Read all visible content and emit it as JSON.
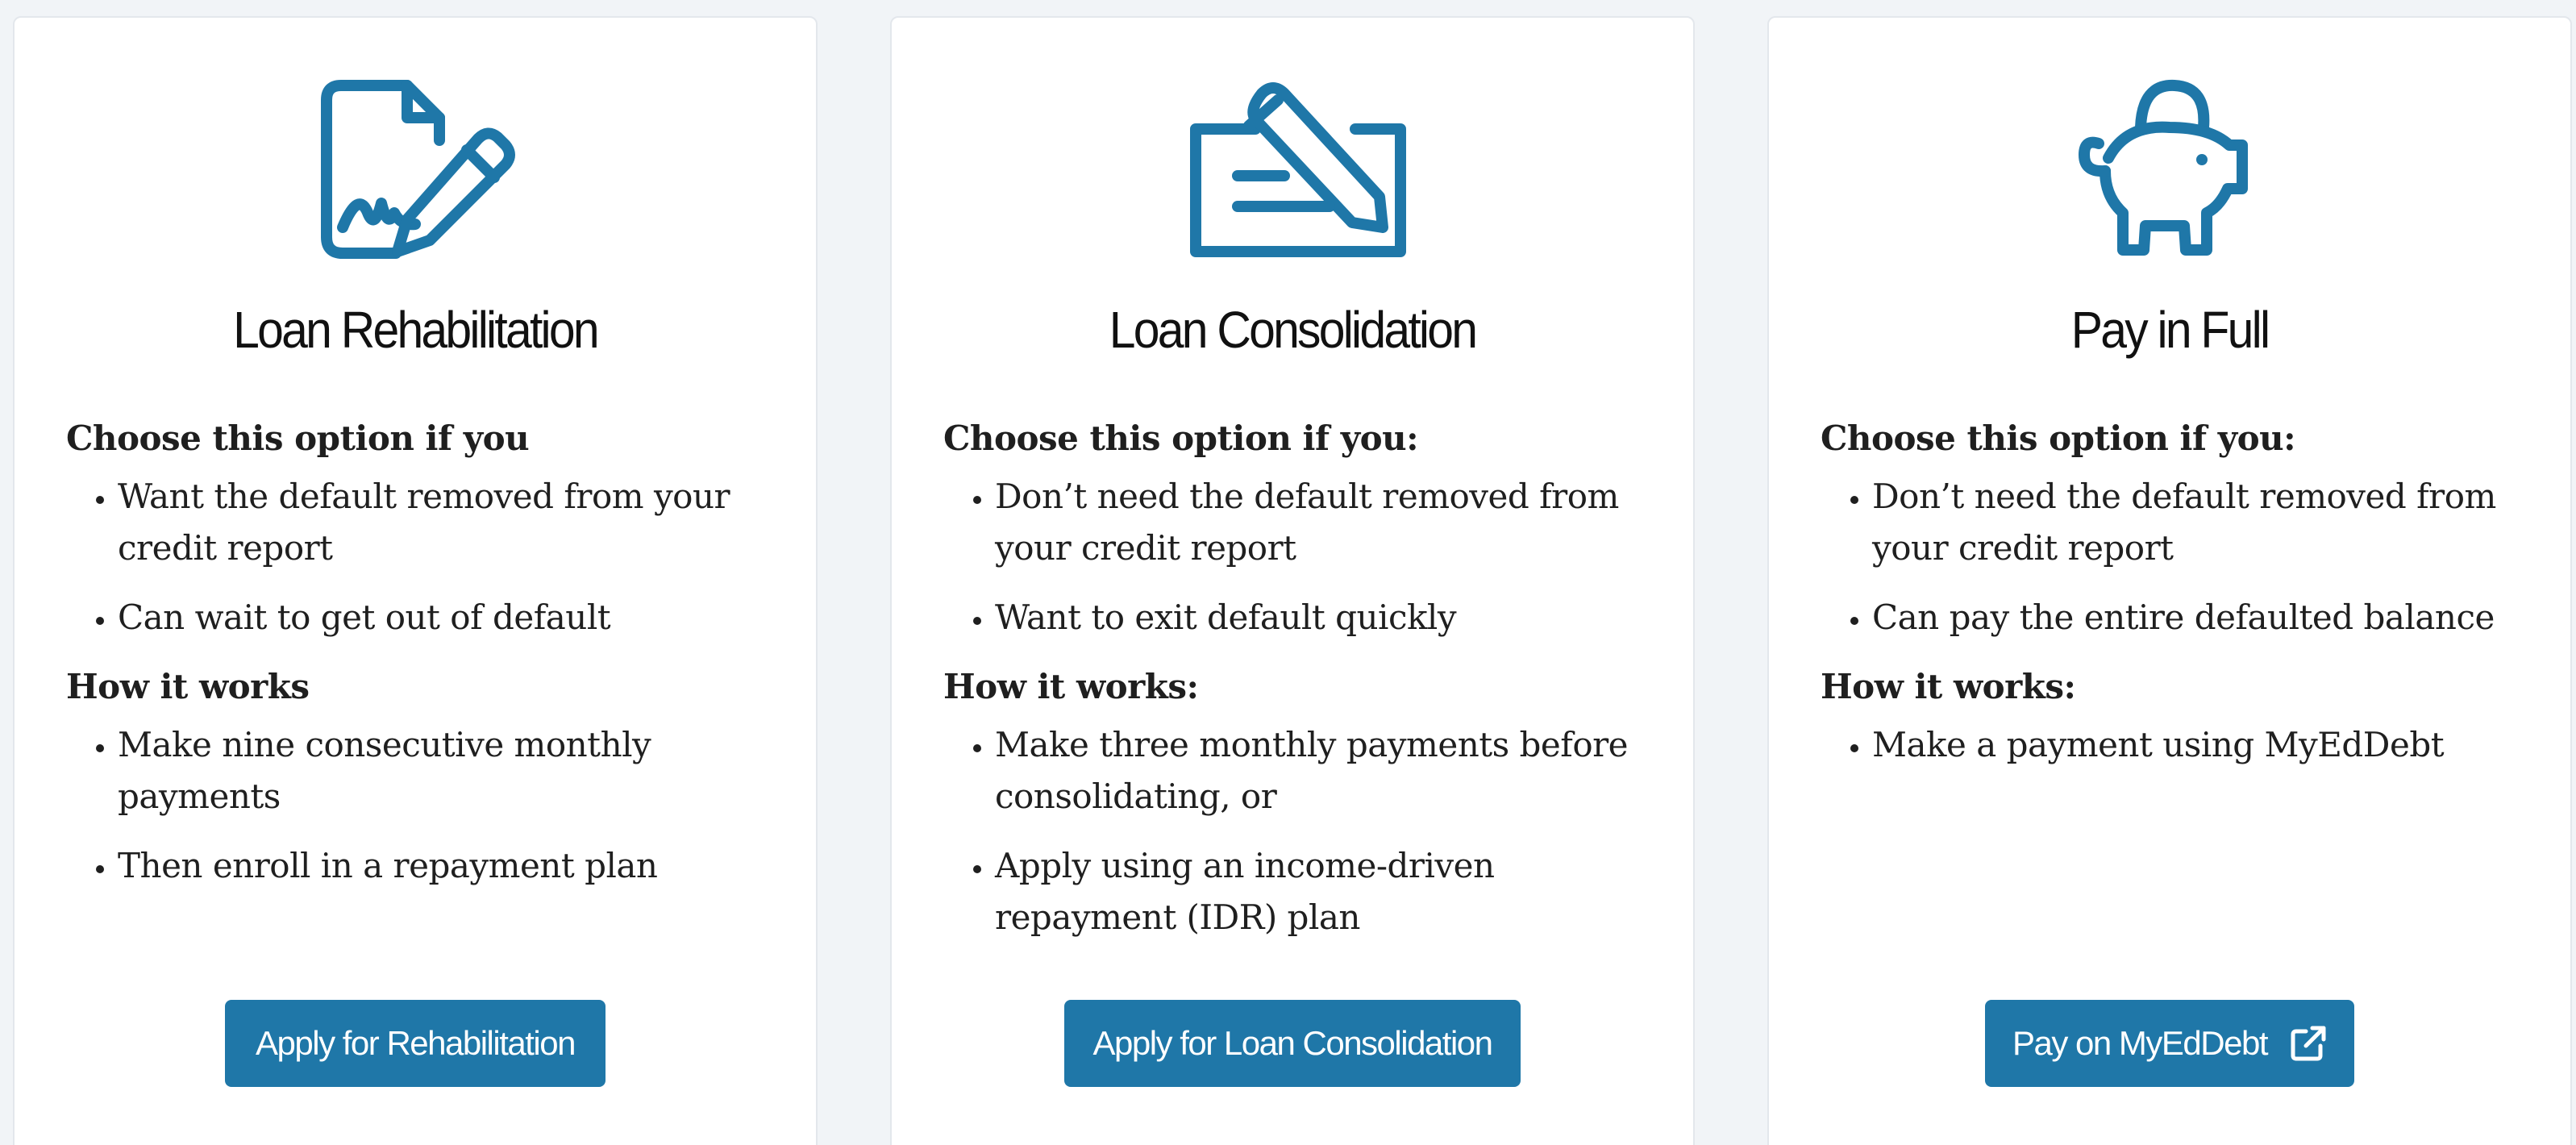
{
  "colors": {
    "accent": "#1f77a8",
    "card_background": "#ffffff",
    "page_background": "#f1f4f7",
    "text": "#1f1f1f"
  },
  "cards": [
    {
      "icon": "document-signature-icon",
      "title": "Loan Rehabilitation",
      "choose_heading": "Choose this option if you",
      "choose_items": [
        "Want the default removed from your credit report",
        "Can wait to get out of default"
      ],
      "how_heading": "How it works",
      "how_items": [
        "Make nine consecutive monthly payments",
        "Then enroll in a repayment plan"
      ],
      "button_label": "Apply for Rehabilitation"
    },
    {
      "icon": "check-signing-icon",
      "title": "Loan Consolidation",
      "choose_heading": "Choose this option if you:",
      "choose_items": [
        "Don’t need the default removed from your credit report",
        "Want to exit default quickly"
      ],
      "how_heading": "How it works:",
      "how_items": [
        "Make three monthly payments before consolidating, or",
        "Apply using an income-driven repayment (IDR) plan"
      ],
      "button_label": "Apply for Loan Consolidation"
    },
    {
      "icon": "piggy-bank-icon",
      "title": "Pay in Full",
      "choose_heading": "Choose this option if you:",
      "choose_items": [
        "Don’t need the default removed from your credit report",
        "Can pay the entire defaulted balance"
      ],
      "how_heading": "How it works:",
      "how_items": [
        "Make a payment using MyEdDebt"
      ],
      "button_label": "Pay on MyEdDebt",
      "button_icon": "external-link-icon"
    }
  ]
}
